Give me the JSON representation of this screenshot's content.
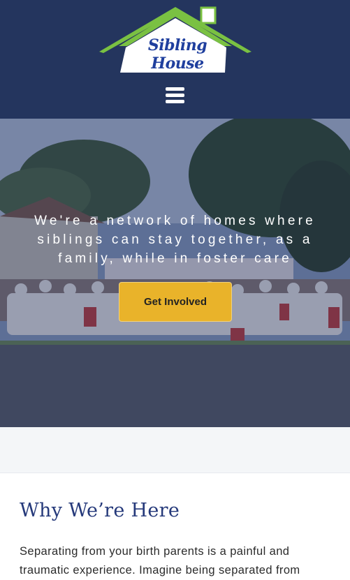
{
  "header": {
    "logo_text": "Sibling House",
    "menu_icon": "hamburger-menu-icon"
  },
  "hero": {
    "tagline": "We're a network of homes where siblings can stay together, as a family, while in foster care",
    "cta_label": "Get Involved"
  },
  "section": {
    "title": "Why We’re Here",
    "body": "Separating from your birth parents is a painful and traumatic experience. Imagine being separated from"
  },
  "colors": {
    "header_bg": "#24355e",
    "logo_roof": "#7ac142",
    "cta_bg": "#e9b32a",
    "title_color": "#25397a"
  }
}
